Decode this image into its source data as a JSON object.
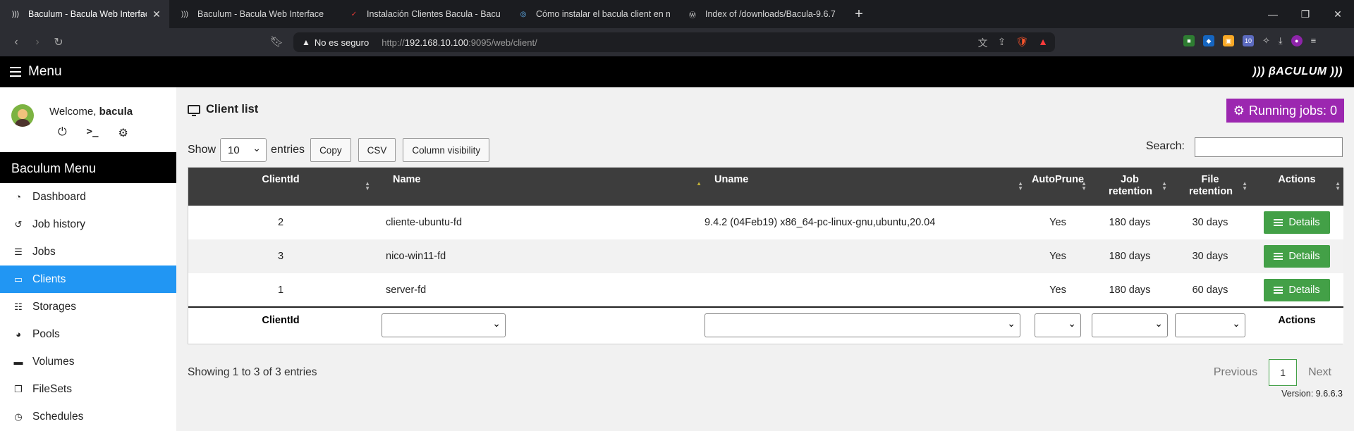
{
  "browser": {
    "tabs": [
      {
        "title": "Baculum - Bacula Web Interface",
        "active": true
      },
      {
        "title": "Baculum - Bacula Web Interface",
        "active": false
      },
      {
        "title": "Instalación Clientes Bacula - Bacula",
        "active": false
      },
      {
        "title": "Cómo instalar el bacula client en m",
        "active": false
      },
      {
        "title": "Index of /downloads/Bacula-9.6.7",
        "active": false
      }
    ],
    "address": {
      "security_label": "No es seguro",
      "url_prefix": "http://",
      "url_host": "192.168.10.100",
      "url_rest": ":9095/web/client/"
    },
    "extension_badge": "10"
  },
  "appbar": {
    "menu_label": "Menu",
    "logo": "))) βACULUM )))"
  },
  "sidebar": {
    "welcome_prefix": "Welcome, ",
    "username": "bacula",
    "menu_title": "Baculum Menu",
    "items": [
      {
        "label": "Dashboard",
        "icon": "dashboard-icon"
      },
      {
        "label": "Job history",
        "icon": "history-icon"
      },
      {
        "label": "Jobs",
        "icon": "tasks-icon"
      },
      {
        "label": "Clients",
        "icon": "desktop-icon",
        "active": true
      },
      {
        "label": "Storages",
        "icon": "database-icon"
      },
      {
        "label": "Pools",
        "icon": "pools-icon"
      },
      {
        "label": "Volumes",
        "icon": "hdd-icon"
      },
      {
        "label": "FileSets",
        "icon": "copy-icon"
      },
      {
        "label": "Schedules",
        "icon": "clock-icon"
      }
    ]
  },
  "main": {
    "title": "Client list",
    "running_jobs": "Running jobs: 0",
    "show_label": "Show",
    "entries_value": "10",
    "entries_label": "entries",
    "buttons": {
      "copy": "Copy",
      "csv": "CSV",
      "colvis": "Column visibility"
    },
    "search_label": "Search:",
    "search_value": "",
    "columns": [
      "ClientId",
      "Name",
      "Uname",
      "AutoPrune",
      "Job retention",
      "File retention",
      "Actions"
    ],
    "rows": [
      {
        "clientid": "2",
        "name": "cliente-ubuntu-fd",
        "uname": "9.4.2 (04Feb19) x86_64-pc-linux-gnu,ubuntu,20.04",
        "autoprune": "Yes",
        "job_retention": "180 days",
        "file_retention": "30 days",
        "action": "Details"
      },
      {
        "clientid": "3",
        "name": "nico-win11-fd",
        "uname": "",
        "autoprune": "Yes",
        "job_retention": "180 days",
        "file_retention": "30 days",
        "action": "Details"
      },
      {
        "clientid": "1",
        "name": "server-fd",
        "uname": "",
        "autoprune": "Yes",
        "job_retention": "180 days",
        "file_retention": "60 days",
        "action": "Details"
      }
    ],
    "footer": {
      "clientid": "ClientId",
      "actions": "Actions"
    },
    "info": "Showing 1 to 3 of 3 entries",
    "pagination": {
      "previous": "Previous",
      "current": "1",
      "next": "Next"
    },
    "version": "Version: 9.6.6.3"
  },
  "colors": {
    "accent": "#2196f3",
    "running": "#9c27b0",
    "details": "#43a047"
  }
}
